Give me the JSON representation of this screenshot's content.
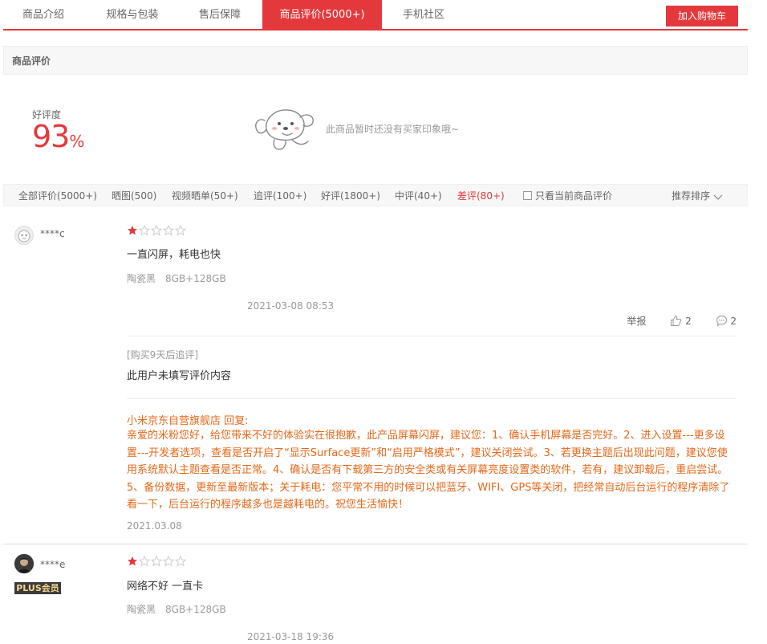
{
  "tabs": [
    {
      "label": "商品介绍",
      "active": false
    },
    {
      "label": "规格与包装",
      "active": false
    },
    {
      "label": "售后保障",
      "active": false
    },
    {
      "label": "商品评价(5000+)",
      "active": true
    },
    {
      "label": "手机社区",
      "active": false
    }
  ],
  "cart_button": "加入购物车",
  "section_title": "商品评价",
  "rating": {
    "label": "好评度",
    "value": "93",
    "unit": "%"
  },
  "empty_impression": "此商品暂时还没有买家印象哦~",
  "filters": [
    {
      "label": "全部评价(5000+)"
    },
    {
      "label": "晒图(500)"
    },
    {
      "label": "视频晒单(50+)"
    },
    {
      "label": "追评(100+)"
    },
    {
      "label": "好评(1800+)"
    },
    {
      "label": "中评(40+)"
    },
    {
      "label": "差评(80+)",
      "active": true
    }
  ],
  "only_current_label": "只看当前商品评价",
  "sort_label": "推荐排序",
  "reviews": [
    {
      "user": "****c",
      "stars": 1,
      "text": "一直闪屏，耗电也快",
      "color": "陶瓷黑",
      "spec": "8GB+128GB",
      "date": "2021-03-08 08:53",
      "report": "举报",
      "likes": "2",
      "comments": "2",
      "followup_tag": "[购买9天后追评]",
      "followup_text": "此用户未填写评价内容",
      "reply_title": "小米京东自营旗舰店 回复:",
      "reply_body": "亲爱的米粉您好，给您带来不好的体验实在很抱歉，此产品屏幕闪屏，建议您：1、确认手机屏幕是否完好。2、进入设置---更多设置---开发者选项，查看是否开启了“显示Surface更新”和“启用严格模式”，建议关闭尝试。3、若更换主题后出现此问题，建议您使用系统默认主题查看是否正常。4、确认是否有下载第三方的安全类或有关屏幕亮度设置类的软件，若有，建议卸载后，重启尝试。5、备份数据，更新至最新版本；关于耗电：您平常不用的时候可以把蓝牙、WIFI、GPS等关闭，把经常自动后台运行的程序清除了看一下，后台运行的程序越多也是越耗电的。祝您生活愉快！",
      "reply_date": "2021.03.08"
    },
    {
      "user": "****e",
      "badge": "PLUS会员",
      "stars": 1,
      "text": "网络不好 一直卡",
      "color": "陶瓷黑",
      "spec": "8GB+128GB",
      "date": "2021-03-18 19:36"
    }
  ],
  "colors": {
    "accent": "#e4393c",
    "reply": "#e4681a"
  }
}
